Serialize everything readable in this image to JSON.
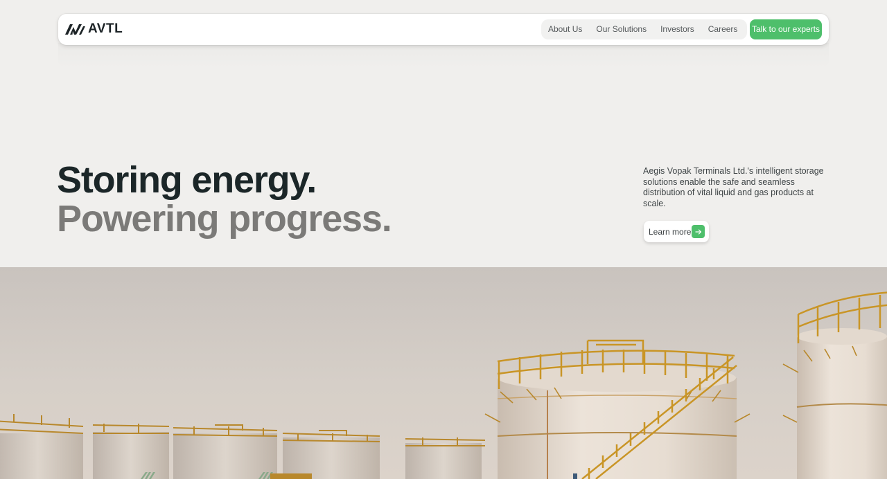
{
  "brand": {
    "name": "AVTL",
    "logo_icon": "avtl-monogram-icon",
    "text_color": "#1c2326"
  },
  "nav": {
    "links": [
      {
        "label": "About Us"
      },
      {
        "label": "Our Solutions"
      },
      {
        "label": "Investors"
      },
      {
        "label": "Careers"
      }
    ],
    "cta_label": "Talk to our experts",
    "cta_color": "#4ebf6b"
  },
  "hero": {
    "headline_line1": "Storing energy.",
    "headline_line2": "Powering progress.",
    "headline_line1_color": "#1b2628",
    "headline_line2_color": "#7b7a78",
    "description": "Aegis Vopak Terminals Ltd.'s intelligent storage solutions enable the safe and seamless distribution of vital liquid and gas products at scale.",
    "learn_more_label": "Learn more",
    "learn_more_icon": "arrow-right-icon"
  },
  "hero_image": {
    "subject": "storage-tank-farm-photo",
    "background_color": "#f0efed"
  }
}
